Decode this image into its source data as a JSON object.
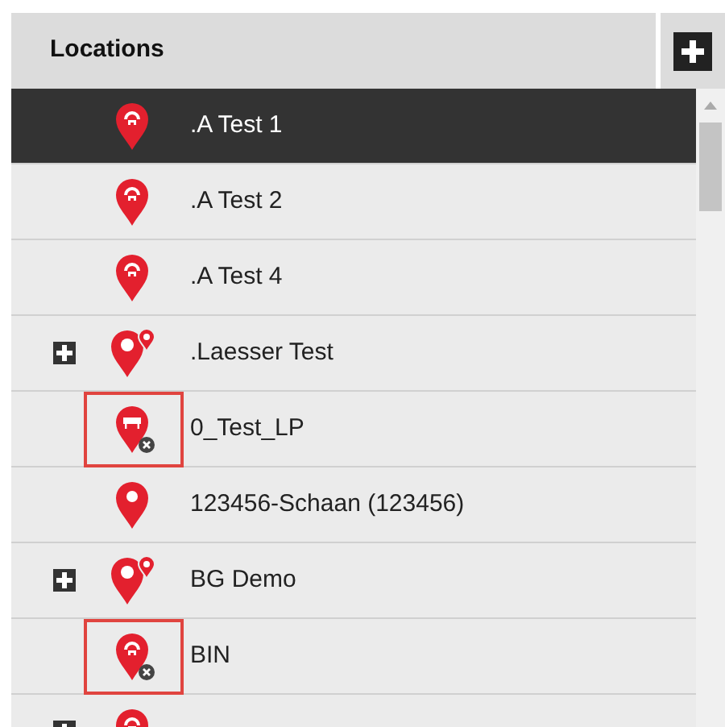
{
  "header": {
    "title": "Locations"
  },
  "locations": [
    {
      "label": ".A Test 1",
      "kind": "home",
      "selected": true,
      "expandable": false,
      "deactivated": false,
      "marked": false
    },
    {
      "label": ".A Test 2",
      "kind": "home",
      "selected": false,
      "expandable": false,
      "deactivated": false,
      "marked": false
    },
    {
      "label": ".A Test 4",
      "kind": "home",
      "selected": false,
      "expandable": false,
      "deactivated": false,
      "marked": false
    },
    {
      "label": ".Laesser Test",
      "kind": "group",
      "selected": false,
      "expandable": true,
      "deactivated": false,
      "marked": false
    },
    {
      "label": "0_Test_LP",
      "kind": "barrier",
      "selected": false,
      "expandable": false,
      "deactivated": true,
      "marked": true
    },
    {
      "label": "123456-Schaan (123456)",
      "kind": "plain",
      "selected": false,
      "expandable": false,
      "deactivated": false,
      "marked": false
    },
    {
      "label": "BG Demo",
      "kind": "group",
      "selected": false,
      "expandable": true,
      "deactivated": false,
      "marked": false
    },
    {
      "label": "BIN",
      "kind": "home",
      "selected": false,
      "expandable": false,
      "deactivated": true,
      "marked": true
    },
    {
      "kind": "home",
      "selected": false,
      "expandable": true,
      "deactivated": false,
      "marked": false
    }
  ]
}
